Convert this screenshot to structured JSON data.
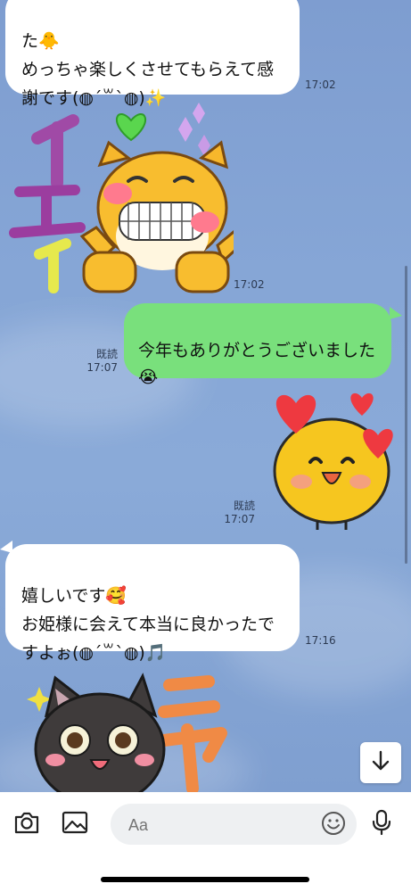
{
  "messages": [
    {
      "side": "left",
      "text": "た🐥\nめっちゃ楽しくさせてもらえて感謝です(◍︎´꒳`◍︎)✨",
      "time": "17:02"
    },
    {
      "side": "left",
      "sticker": "cat-peace-sticker",
      "sticker_text": "イエイ",
      "time": "17:02"
    },
    {
      "side": "right",
      "text": "今年もありがとうございました😭",
      "read": "既読",
      "time": "17:07"
    },
    {
      "side": "right",
      "sticker": "hearts-face-sticker",
      "read": "既読",
      "time": "17:07"
    },
    {
      "side": "left",
      "text": "嬉しいです🥰\nお姫様に会えて本当に良かったですよぉ(◍︎´꒳`◍︎)🎵",
      "time": "17:16"
    },
    {
      "side": "left",
      "sticker": "black-cat-sticker",
      "sticker_text": "ニャ"
    }
  ],
  "input": {
    "placeholder": "Aa"
  },
  "icons": {
    "camera": "camera-icon",
    "image": "image-icon",
    "emoji": "emoji-icon",
    "mic": "microphone-icon",
    "scroll_down": "arrow-down-icon"
  },
  "colors": {
    "chat_bg": "#7fa0cf",
    "sent_bubble": "#79e07c",
    "received_bubble": "#ffffff"
  }
}
